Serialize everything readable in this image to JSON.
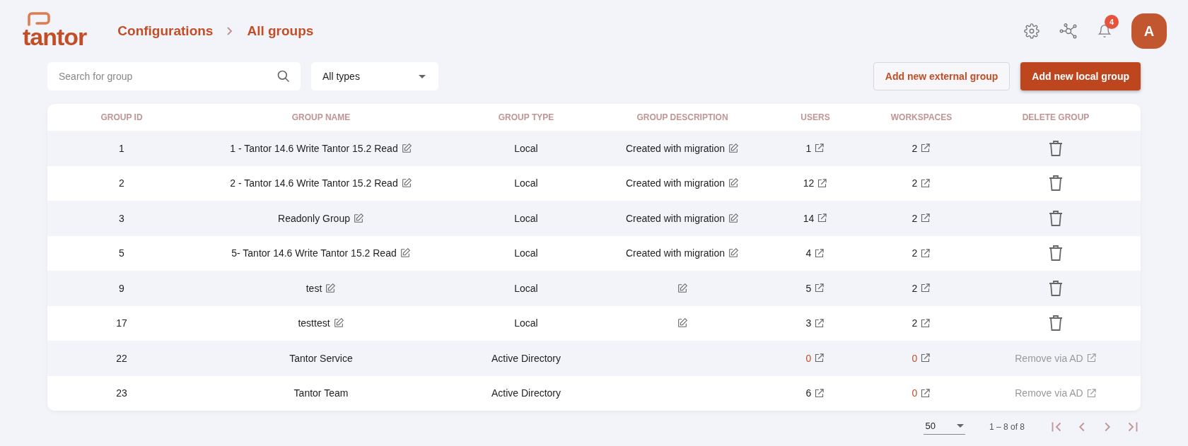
{
  "logo": {
    "text": "tantor"
  },
  "breadcrumb": [
    {
      "label": "Configurations"
    },
    {
      "label": "All groups"
    }
  ],
  "header": {
    "notifications_badge": "4",
    "avatar": "A"
  },
  "search": {
    "placeholder": "Search for group"
  },
  "type_filter": {
    "value": "All types"
  },
  "buttons": [
    {
      "label": "Add new external group",
      "kind": "outline"
    },
    {
      "label": "Add new local group",
      "kind": "primary"
    }
  ],
  "table": {
    "columns": [
      "GROUP ID",
      "GROUP NAME",
      "GROUP TYPE",
      "GROUP DESCRIPTION",
      "USERS",
      "WORKSPACES",
      "DELETE GROUP"
    ],
    "rows": [
      {
        "id": "1",
        "name": "1 - Tantor 14.6 Write Tantor 15.2 Read",
        "editable": true,
        "type": "Local",
        "description": "Created with migration",
        "users": {
          "count": "1",
          "alert": false
        },
        "workspaces": {
          "count": "2",
          "alert": false
        },
        "delete": {
          "kind": "trash"
        }
      },
      {
        "id": "2",
        "name": "2 - Tantor 14.6 Write Tantor 15.2 Read",
        "editable": true,
        "type": "Local",
        "description": "Created with migration",
        "users": {
          "count": "12",
          "alert": false
        },
        "workspaces": {
          "count": "2",
          "alert": false
        },
        "delete": {
          "kind": "trash"
        }
      },
      {
        "id": "3",
        "name": "Readonly Group",
        "editable": true,
        "type": "Local",
        "description": "Created with migration",
        "users": {
          "count": "14",
          "alert": false
        },
        "workspaces": {
          "count": "2",
          "alert": false
        },
        "delete": {
          "kind": "trash"
        }
      },
      {
        "id": "5",
        "name": "5- Tantor 14.6 Write Tantor 15.2 Read",
        "editable": true,
        "type": "Local",
        "description": "Created with migration",
        "users": {
          "count": "4",
          "alert": false
        },
        "workspaces": {
          "count": "2",
          "alert": false
        },
        "delete": {
          "kind": "trash"
        }
      },
      {
        "id": "9",
        "name": "test",
        "editable": true,
        "type": "Local",
        "description": "",
        "users": {
          "count": "5",
          "alert": false
        },
        "workspaces": {
          "count": "2",
          "alert": false
        },
        "delete": {
          "kind": "trash"
        }
      },
      {
        "id": "17",
        "name": "testtest",
        "editable": true,
        "type": "Local",
        "description": "",
        "users": {
          "count": "3",
          "alert": false
        },
        "workspaces": {
          "count": "2",
          "alert": false
        },
        "delete": {
          "kind": "trash"
        }
      },
      {
        "id": "22",
        "name": "Tantor Service",
        "editable": false,
        "type": "Active Directory",
        "users": {
          "count": "0",
          "alert": true
        },
        "workspaces": {
          "count": "0",
          "alert": true
        },
        "delete": {
          "kind": "link",
          "label": "Remove via AD"
        }
      },
      {
        "id": "23",
        "name": "Tantor Team",
        "editable": false,
        "type": "Active Directory",
        "users": {
          "count": "6",
          "alert": false
        },
        "workspaces": {
          "count": "0",
          "alert": true
        },
        "delete": {
          "kind": "link",
          "label": "Remove via AD"
        }
      }
    ]
  },
  "pagination": {
    "page_size": "50",
    "range": "1 – 8 of 8"
  }
}
